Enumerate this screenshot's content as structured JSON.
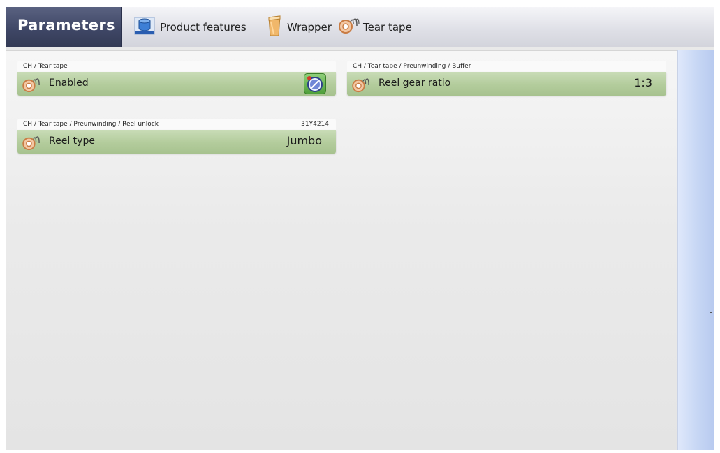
{
  "header": {
    "title": "Parameters",
    "breadcrumbs": [
      {
        "label": "Product features",
        "icon": "product-features-icon"
      },
      {
        "label": "Wrapper",
        "icon": "wrapper-icon"
      },
      {
        "label": "Tear tape",
        "icon": "tear-tape-icon"
      }
    ]
  },
  "cards": {
    "enabled": {
      "path": "CH / Tear tape",
      "label": "Enabled",
      "icon": "tear-tape-icon",
      "control": "toggle-icon"
    },
    "reel_type": {
      "path": "CH / Tear tape / Preunwinding / Reel unlock",
      "code": "31Y4214",
      "label": "Reel type",
      "value": "Jumbo",
      "icon": "tear-tape-icon"
    },
    "reel_gear_ratio": {
      "path": "CH / Tear tape / Preunwinding / Buffer",
      "label": "Reel gear ratio",
      "value": "1:3",
      "icon": "tear-tape-icon"
    }
  },
  "colors": {
    "title_bg": "#3f4766",
    "card_green": "#b3cc9c",
    "scrollbar": "#c6d6f4"
  }
}
